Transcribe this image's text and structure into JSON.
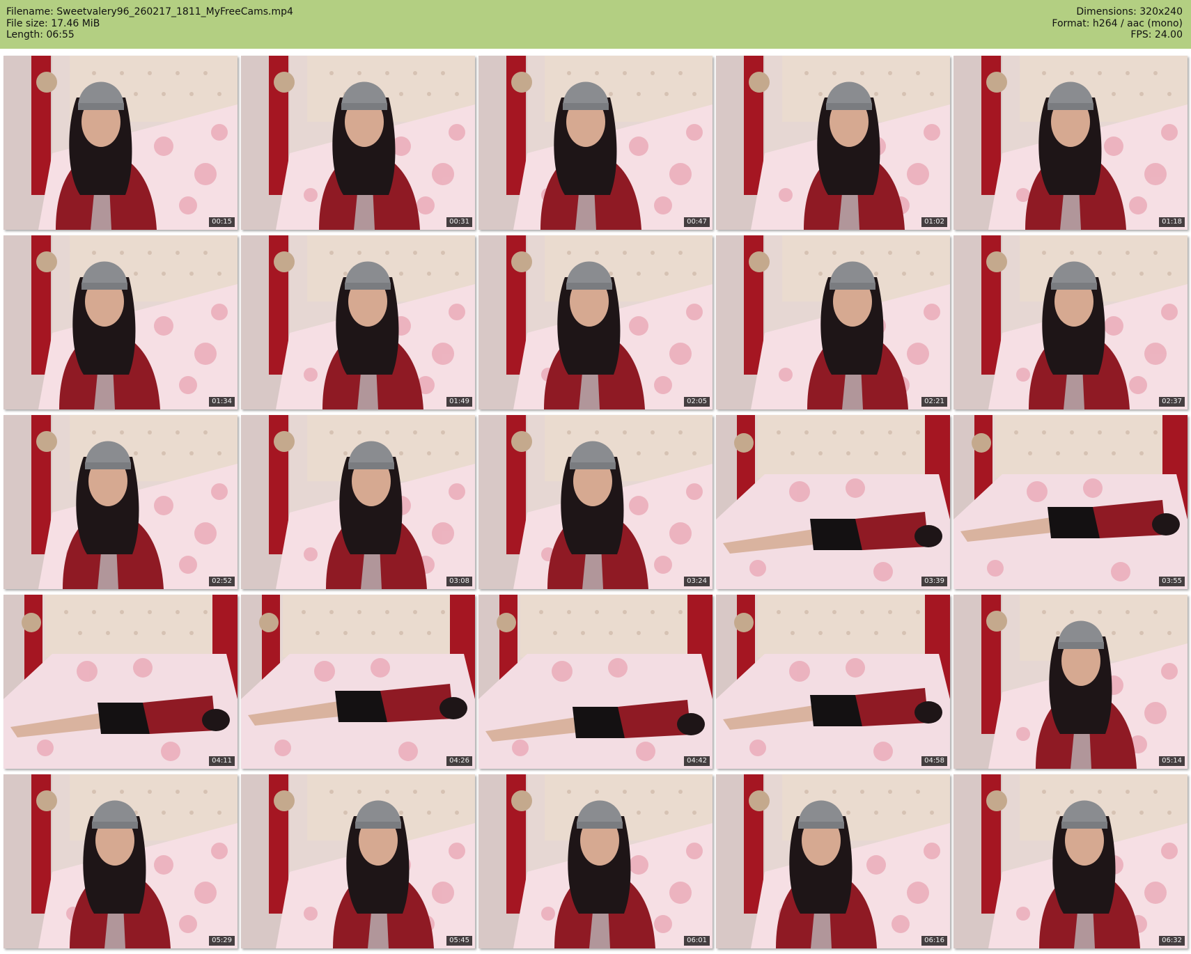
{
  "header": {
    "filename_line": "Filename: Sweetvalery96_260217_1811_MyFreeCams.mp4",
    "filesize_line": "File size: 17.46 MiB",
    "length_line": "Length: 06:55",
    "dimensions_line": "Dimensions: 320x240",
    "format_line": "Format: h264 / aac (mono)",
    "fps_line": "FPS: 24.00"
  },
  "colors": {
    "header_bg": "#b3cf82",
    "timestamp_bg": "#000000"
  },
  "thumbnails": [
    {
      "time": "00:15",
      "scene": "sitting"
    },
    {
      "time": "00:31",
      "scene": "sitting"
    },
    {
      "time": "00:47",
      "scene": "sitting"
    },
    {
      "time": "01:02",
      "scene": "sitting"
    },
    {
      "time": "01:18",
      "scene": "sitting"
    },
    {
      "time": "01:34",
      "scene": "sitting"
    },
    {
      "time": "01:49",
      "scene": "sitting"
    },
    {
      "time": "02:05",
      "scene": "sitting"
    },
    {
      "time": "02:21",
      "scene": "sitting"
    },
    {
      "time": "02:37",
      "scene": "sitting"
    },
    {
      "time": "02:52",
      "scene": "sitting"
    },
    {
      "time": "03:08",
      "scene": "sitting"
    },
    {
      "time": "03:24",
      "scene": "sitting"
    },
    {
      "time": "03:39",
      "scene": "lying"
    },
    {
      "time": "03:55",
      "scene": "lying"
    },
    {
      "time": "04:11",
      "scene": "lying"
    },
    {
      "time": "04:26",
      "scene": "lying"
    },
    {
      "time": "04:42",
      "scene": "lying"
    },
    {
      "time": "04:58",
      "scene": "lying"
    },
    {
      "time": "05:14",
      "scene": "sitting"
    },
    {
      "time": "05:29",
      "scene": "sitting"
    },
    {
      "time": "05:45",
      "scene": "sitting"
    },
    {
      "time": "06:01",
      "scene": "sitting"
    },
    {
      "time": "06:16",
      "scene": "sitting"
    },
    {
      "time": "06:32",
      "scene": "sitting"
    }
  ]
}
